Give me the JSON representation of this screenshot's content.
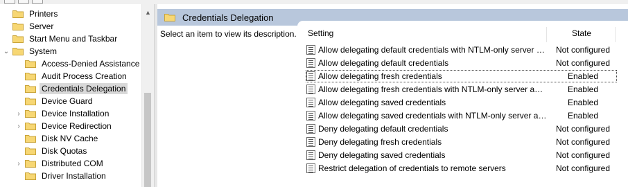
{
  "tree": {
    "items": [
      {
        "label": "Printers",
        "level": 1,
        "expander": "",
        "selected": false
      },
      {
        "label": "Server",
        "level": 1,
        "expander": "",
        "selected": false
      },
      {
        "label": "Start Menu and Taskbar",
        "level": 1,
        "expander": "",
        "selected": false
      },
      {
        "label": "System",
        "level": 1,
        "expander": "expanded",
        "selected": false
      },
      {
        "label": "Access-Denied Assistance",
        "level": 2,
        "expander": "",
        "selected": false
      },
      {
        "label": "Audit Process Creation",
        "level": 2,
        "expander": "",
        "selected": false
      },
      {
        "label": "Credentials Delegation",
        "level": 2,
        "expander": "",
        "selected": true
      },
      {
        "label": "Device Guard",
        "level": 2,
        "expander": "",
        "selected": false
      },
      {
        "label": "Device Installation",
        "level": 2,
        "expander": "collapsed",
        "selected": false
      },
      {
        "label": "Device Redirection",
        "level": 2,
        "expander": "collapsed",
        "selected": false
      },
      {
        "label": "Disk NV Cache",
        "level": 2,
        "expander": "",
        "selected": false
      },
      {
        "label": "Disk Quotas",
        "level": 2,
        "expander": "",
        "selected": false
      },
      {
        "label": "Distributed COM",
        "level": 2,
        "expander": "collapsed",
        "selected": false
      },
      {
        "label": "Driver Installation",
        "level": 2,
        "expander": "",
        "selected": false
      }
    ]
  },
  "header": {
    "title": "Credentials Delegation"
  },
  "description": {
    "text": "Select an item to view its description."
  },
  "list": {
    "columns": {
      "setting": "Setting",
      "state": "State"
    },
    "rows": [
      {
        "name": "Allow delegating default credentials with NTLM-only server authentication",
        "state": "Not configured"
      },
      {
        "name": "Allow delegating default credentials",
        "state": "Not configured"
      },
      {
        "name": "Allow delegating fresh credentials",
        "state": "Enabled"
      },
      {
        "name": "Allow delegating fresh credentials with NTLM-only server authentication",
        "state": "Enabled"
      },
      {
        "name": "Allow delegating saved credentials",
        "state": "Enabled"
      },
      {
        "name": "Allow delegating saved credentials with NTLM-only server authentication",
        "state": "Enabled"
      },
      {
        "name": "Deny delegating default credentials",
        "state": "Not configured"
      },
      {
        "name": "Deny delegating fresh credentials",
        "state": "Not configured"
      },
      {
        "name": "Deny delegating saved credentials",
        "state": "Not configured"
      },
      {
        "name": "Restrict delegation of credentials to remote servers",
        "state": "Not configured"
      }
    ]
  },
  "colors": {
    "header_bg": "#b8c7dc",
    "folder": "#f7d774",
    "selection": "#d9d9d9"
  },
  "icons": {
    "folder": "folder-icon",
    "policy": "policy-setting-icon",
    "expand": "chevron-right-icon",
    "collapse": "chevron-down-icon"
  }
}
